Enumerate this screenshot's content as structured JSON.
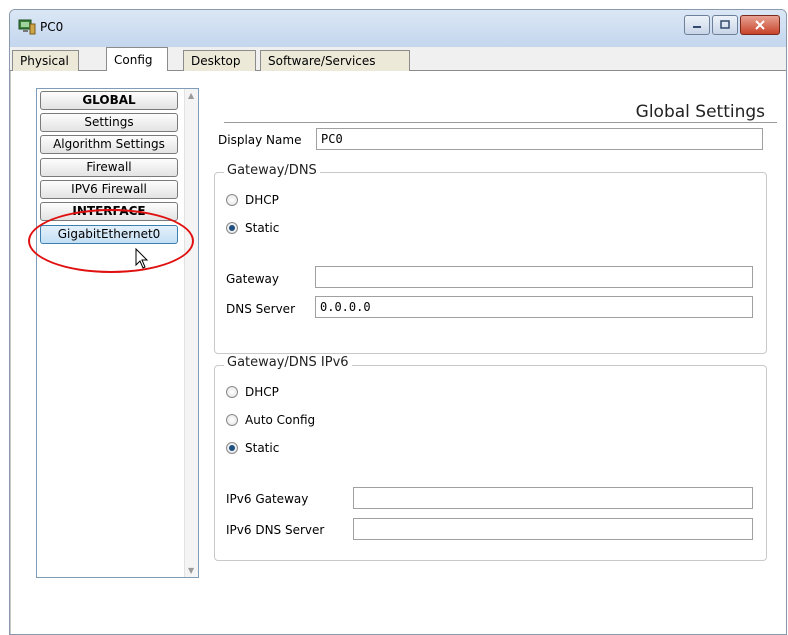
{
  "window": {
    "title": "PC0"
  },
  "tabs": [
    {
      "label": "Physical"
    },
    {
      "label": "Config"
    },
    {
      "label": "Desktop"
    },
    {
      "label": "Software/Services"
    }
  ],
  "sidebar": {
    "items": [
      {
        "label": "GLOBAL"
      },
      {
        "label": "Settings"
      },
      {
        "label": "Algorithm Settings"
      },
      {
        "label": "Firewall"
      },
      {
        "label": "IPV6 Firewall"
      },
      {
        "label": "INTERFACE"
      },
      {
        "label": "GigabitEthernet0"
      }
    ]
  },
  "main": {
    "title": "Global Settings",
    "display_name_label": "Display Name",
    "display_name_value": "PC0",
    "gateway_dns": {
      "title": "Gateway/DNS",
      "dhcp_label": "DHCP",
      "static_label": "Static",
      "gateway_label": "Gateway",
      "gateway_value": "",
      "dns_label": "DNS Server",
      "dns_value": "0.0.0.0"
    },
    "gateway_dns_ipv6": {
      "title": "Gateway/DNS IPv6",
      "dhcp_label": "DHCP",
      "auto_config_label": "Auto Config",
      "static_label": "Static",
      "ipv6_gateway_label": "IPv6 Gateway",
      "ipv6_gateway_value": "",
      "ipv6_dns_label": "IPv6 DNS Server",
      "ipv6_dns_value": ""
    }
  },
  "colors": {
    "annotation_circle": "#e01010",
    "selected_item": "#c3e0f4",
    "radio_checked": "#1f4f7f"
  }
}
